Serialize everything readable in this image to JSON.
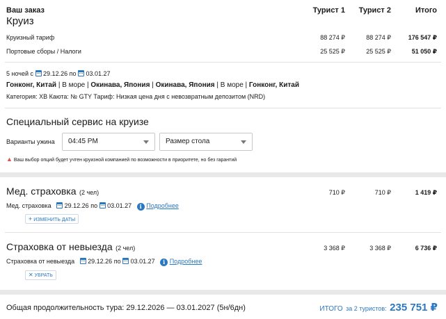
{
  "order": {
    "title": "Ваш заказ",
    "subtitle": "Круиз",
    "columns": [
      "Турист 1",
      "Турист 2",
      "Итого"
    ],
    "rows": [
      {
        "label": "Круизный тариф",
        "t1": "88 274 ₽",
        "t2": "88 274 ₽",
        "total": "176 547 ₽"
      },
      {
        "label": "Портовые сборы / Налоги",
        "t1": "25 525 ₽",
        "t2": "25 525 ₽",
        "total": "51 050 ₽"
      }
    ]
  },
  "cruise": {
    "nights": "5 ночей с",
    "date_from": "29.12.26",
    "by": "по",
    "date_to": "03.01.27",
    "route": [
      {
        "text": "Гонконг, Китай",
        "bold": true
      },
      {
        "text": " | ",
        "bold": false
      },
      {
        "text": "В море",
        "bold": false
      },
      {
        "text": " | ",
        "bold": false
      },
      {
        "text": "Окинава, Япония",
        "bold": true
      },
      {
        "text": " | ",
        "bold": false
      },
      {
        "text": "Окинава, Япония",
        "bold": true
      },
      {
        "text": " | ",
        "bold": false
      },
      {
        "text": "В море",
        "bold": false
      },
      {
        "text": " | ",
        "bold": false
      },
      {
        "text": "Гонконг, Китай",
        "bold": true
      }
    ],
    "details": "Категория: XB  Каюта: № GTY  Тариф: Низкая цена дня с невозвратным депозитом (NRD)"
  },
  "special": {
    "title": "Специальный сервис на круизе",
    "dinner_label": "Варианты ужина",
    "dinner_value": "04:45 PM",
    "table_value": "Размер стола",
    "warning": "Ваш выбор опций будет учтен круизной компанией по возможности в приоритете, но без гарантий"
  },
  "medical": {
    "title": "Мед. страховка",
    "count": "(2 чел)",
    "t1": "710 ₽",
    "t2": "710 ₽",
    "total": "1 419 ₽",
    "line_label": "Мед. страховка",
    "date_from": "29.12.26",
    "by": "по",
    "date_to": "03.01.27",
    "more": "Подробнее",
    "button": "Изменить даты"
  },
  "cancel": {
    "title": "Страховка от невыезда",
    "count": "(2 чел)",
    "t1": "3 368 ₽",
    "t2": "3 368 ₽",
    "total": "6 736 ₽",
    "line_label": "Страховка от невыезда",
    "date_from": "29.12.26",
    "by": "по",
    "date_to": "03.01.27",
    "more": "Подробнее",
    "button": "Убрать"
  },
  "footer": {
    "duration": "Общая продолжительность тура: 29.12.2026 — 03.01.2027 (5н/6дн)",
    "total_label": "ИТОГО",
    "total_for": "за 2 туристов:",
    "total_value": "235 751 ₽"
  },
  "colors": {
    "accent": "#2b78c2",
    "warning": "#d9534f"
  }
}
